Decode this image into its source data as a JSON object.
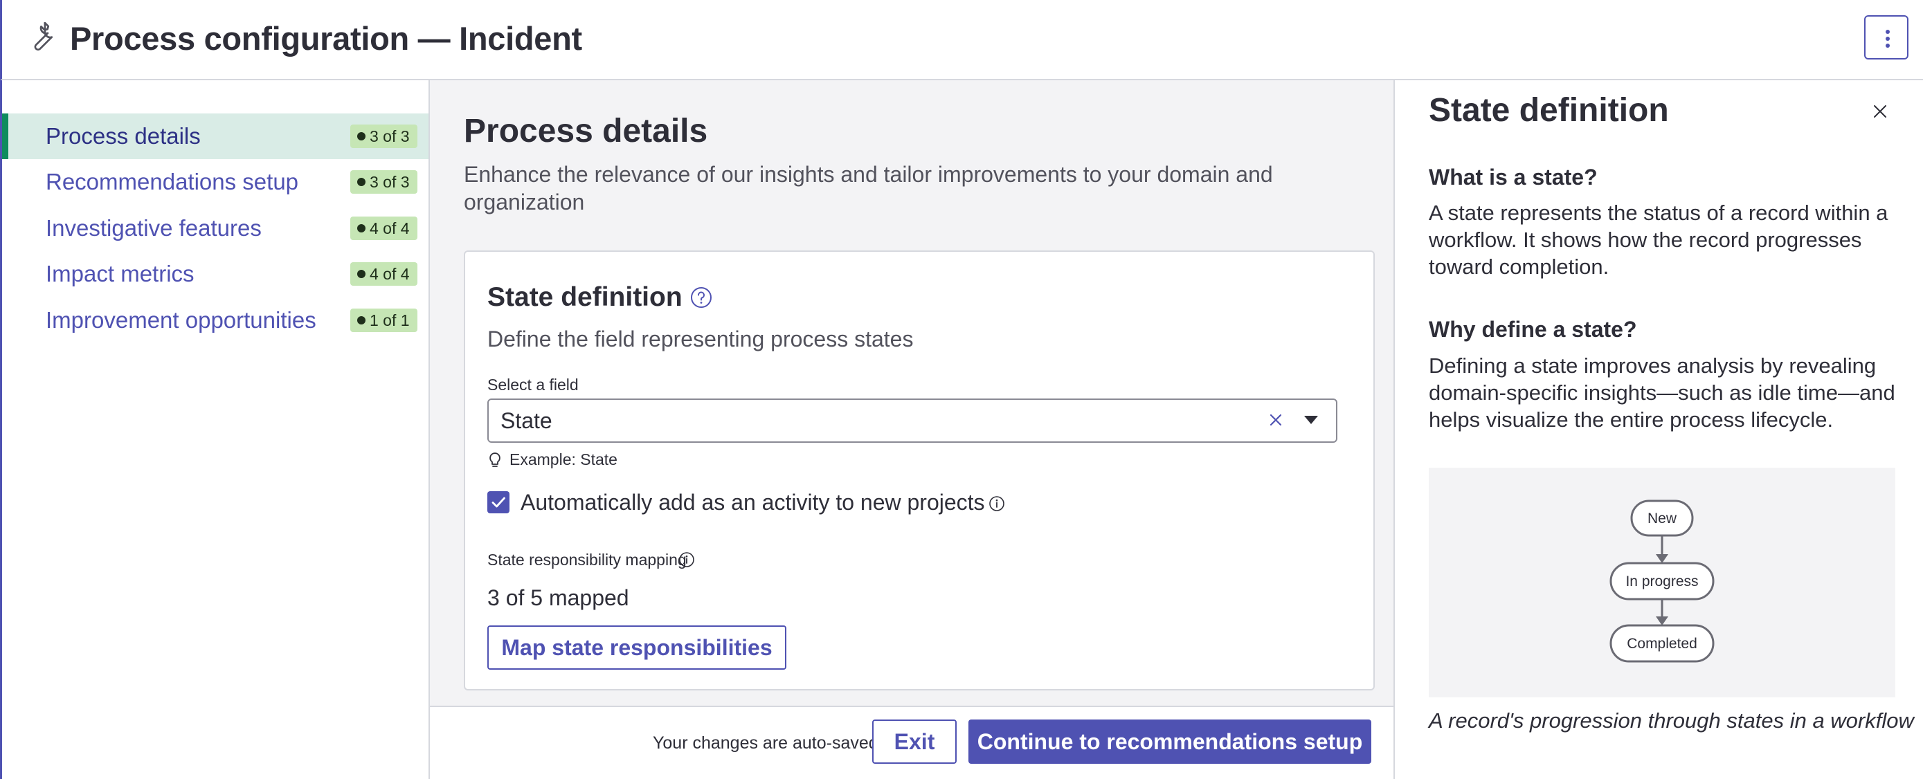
{
  "header": {
    "title": "Process configuration — Incident",
    "icon": "wrench-icon",
    "more_icon": "more-vertical-icon"
  },
  "sidebar": {
    "items": [
      {
        "label": "Process details",
        "badge": "3 of 3",
        "active": true
      },
      {
        "label": "Recommendations setup",
        "badge": "3 of 3",
        "active": false
      },
      {
        "label": "Investigative features",
        "badge": "4 of 4",
        "active": false
      },
      {
        "label": "Impact metrics",
        "badge": "4 of 4",
        "active": false
      },
      {
        "label": "Improvement opportunities",
        "badge": "1 of 1",
        "active": false
      }
    ]
  },
  "main": {
    "title": "Process details",
    "description": "Enhance the relevance of our insights and tailor improvements to your domain and organization",
    "card": {
      "title": "State definition",
      "subtitle": "Define the field representing process states",
      "field_label": "Select a field",
      "field_value": "State",
      "hint": "Example: State",
      "checkbox_label": "Automatically add as an activity to new projects",
      "checkbox_checked": true,
      "mapping_label": "State responsibility mapping",
      "mapping_count": "3 of 5 mapped",
      "map_button": "Map state responsibilities"
    },
    "footer": {
      "autosave": "Your changes are auto-saved",
      "exit_button": "Exit",
      "continue_button": "Continue to recommendations setup"
    }
  },
  "panel": {
    "title": "State definition",
    "q1": "What is a state?",
    "a1": "A state represents the status of a record within a workflow. It shows how the record progresses toward completion.",
    "q2": "Why define a state?",
    "a2": "Defining a state improves analysis by revealing domain-specific insights—such as idle time—and helps visualize the entire process lifecycle.",
    "diagram": {
      "nodes": [
        "New",
        "In progress",
        "Completed"
      ]
    },
    "caption": "A record's progression through states in a workflow"
  },
  "colors": {
    "accent": "#4f52b2",
    "active_bg": "#d9ece6",
    "active_bar": "#0e8c5d",
    "badge_bg": "#c6e6b5",
    "main_bg": "#f3f3f5"
  }
}
